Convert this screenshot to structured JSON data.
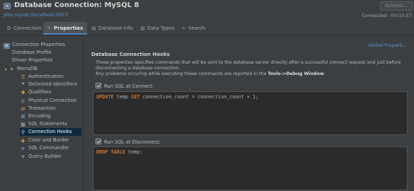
{
  "window": {
    "title": "Database Connection: MySQL 8",
    "jdbc_url": "jdbc:mysql://localhost:3307/",
    "actions_label": "Actions...",
    "status": "Connected - 00:15:57"
  },
  "tabs": [
    {
      "label": "Connection",
      "icon": "plug-icon"
    },
    {
      "label": "Properties",
      "icon": "wrench-icon",
      "active": true
    },
    {
      "label": "Database Info",
      "icon": "database-icon"
    },
    {
      "label": "Data Types",
      "icon": "data-types-icon"
    },
    {
      "label": "Search",
      "icon": "binoculars-icon"
    }
  ],
  "sidebar": {
    "items": [
      {
        "label": "Connection Properties",
        "icon": "properties-icon"
      },
      {
        "label": "Database Profile"
      },
      {
        "label": "Driver Properties"
      },
      {
        "label": "MariaDB",
        "icon": "mariadb-icon"
      },
      {
        "label": "Authentication",
        "icon": "authentication-icon"
      },
      {
        "label": "Delimited Identifiers",
        "icon": "delimited-identifiers-icon"
      },
      {
        "label": "Qualifiers",
        "icon": "qualifiers-icon"
      },
      {
        "label": "Physical Connection",
        "icon": "physical-connection-icon"
      },
      {
        "label": "Transaction",
        "icon": "transaction-icon"
      },
      {
        "label": "Encoding",
        "icon": "encoding-icon"
      },
      {
        "label": "SQL Statements",
        "icon": "sql-statements-icon"
      },
      {
        "label": "Connection Hooks",
        "icon": "hook-icon",
        "selected": true
      },
      {
        "label": "Color and Border",
        "icon": "palette-icon"
      },
      {
        "label": "SQL Commander",
        "icon": "sql-commander-icon"
      },
      {
        "label": "Query Builder",
        "icon": "query-builder-icon"
      }
    ]
  },
  "main": {
    "global_properties_link": "Global Properti...",
    "section_title": "Database Connection Hooks",
    "description": {
      "line1": "These properties specifies commands that will be sent to the database server directly after a successful connect request and just before",
      "line2": "disconnecting a database connection.",
      "line3_prefix": "Any problems occuring while executing these commands are reported in the ",
      "line3_bold": "Tools->Debug Window",
      "line3_suffix": "."
    },
    "connect": {
      "label": "Run SQL at Connect:",
      "checked": true,
      "sql_kw1": "UPDATE",
      "sql_t1": " temp ",
      "sql_kw2": "SET",
      "sql_t2": " connection_count = connection_count + 1;"
    },
    "disconnect": {
      "label": "Run SQL at Disconnect:",
      "checked": true,
      "sql_kw1": "DROP",
      "sql_t1": " ",
      "sql_kw2": "TABLE",
      "sql_t2": " temp;"
    }
  }
}
